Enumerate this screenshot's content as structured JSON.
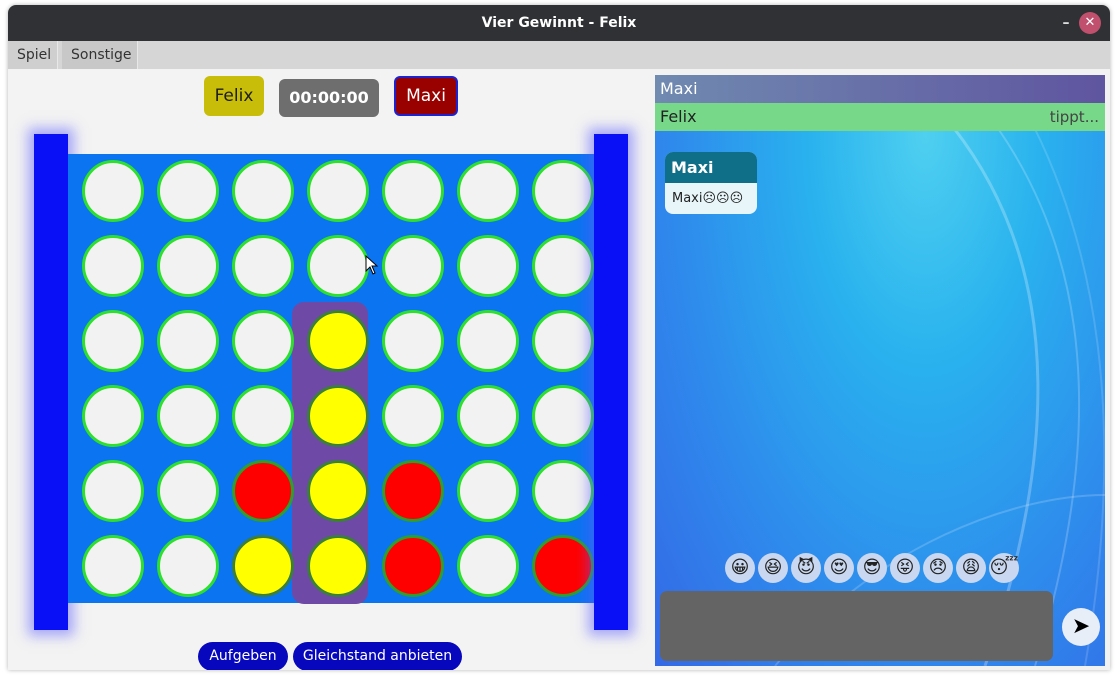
{
  "window": {
    "title": "Vier Gewinnt - Felix",
    "minimize": "–",
    "close": "✕"
  },
  "menu": [
    "Spiel",
    "Sonstige"
  ],
  "players": {
    "left": "Felix",
    "timer": "00:00:00",
    "right": "Maxi"
  },
  "board": {
    "rows": 6,
    "cols": 7,
    "cells": [
      [
        "empty",
        "empty",
        "empty",
        "empty",
        "empty",
        "empty",
        "empty"
      ],
      [
        "empty",
        "empty",
        "empty",
        "empty",
        "empty",
        "empty",
        "empty"
      ],
      [
        "empty",
        "empty",
        "empty",
        "yellow",
        "empty",
        "empty",
        "empty"
      ],
      [
        "empty",
        "empty",
        "empty",
        "yellow",
        "empty",
        "empty",
        "empty"
      ],
      [
        "empty",
        "empty",
        "red",
        "yellow",
        "red",
        "empty",
        "empty"
      ],
      [
        "empty",
        "empty",
        "yellow",
        "yellow",
        "red",
        "empty",
        "red"
      ]
    ],
    "winning_column": 3
  },
  "actions": {
    "give_up": "Aufgeben",
    "offer_draw": "Gleichstand anbieten"
  },
  "chat": {
    "participants": [
      {
        "name": "Maxi",
        "status": ""
      },
      {
        "name": "Felix",
        "status": "tippt..."
      }
    ],
    "messages": [
      {
        "sender": "Maxi",
        "text": "Maxi☹☹☹"
      }
    ],
    "emojis": [
      "😀",
      "😆",
      "😈",
      "😍",
      "😎",
      "😝",
      "😞",
      "😩",
      "😴"
    ],
    "send_icon": "➤"
  },
  "colors": {
    "board": "#0b74f0",
    "post": "#0a10f5",
    "yellow": "#ffff00",
    "red": "#ff0000",
    "ring": "#2ce02c",
    "highlight": "#6e4aa6",
    "button": "#0707bd"
  }
}
